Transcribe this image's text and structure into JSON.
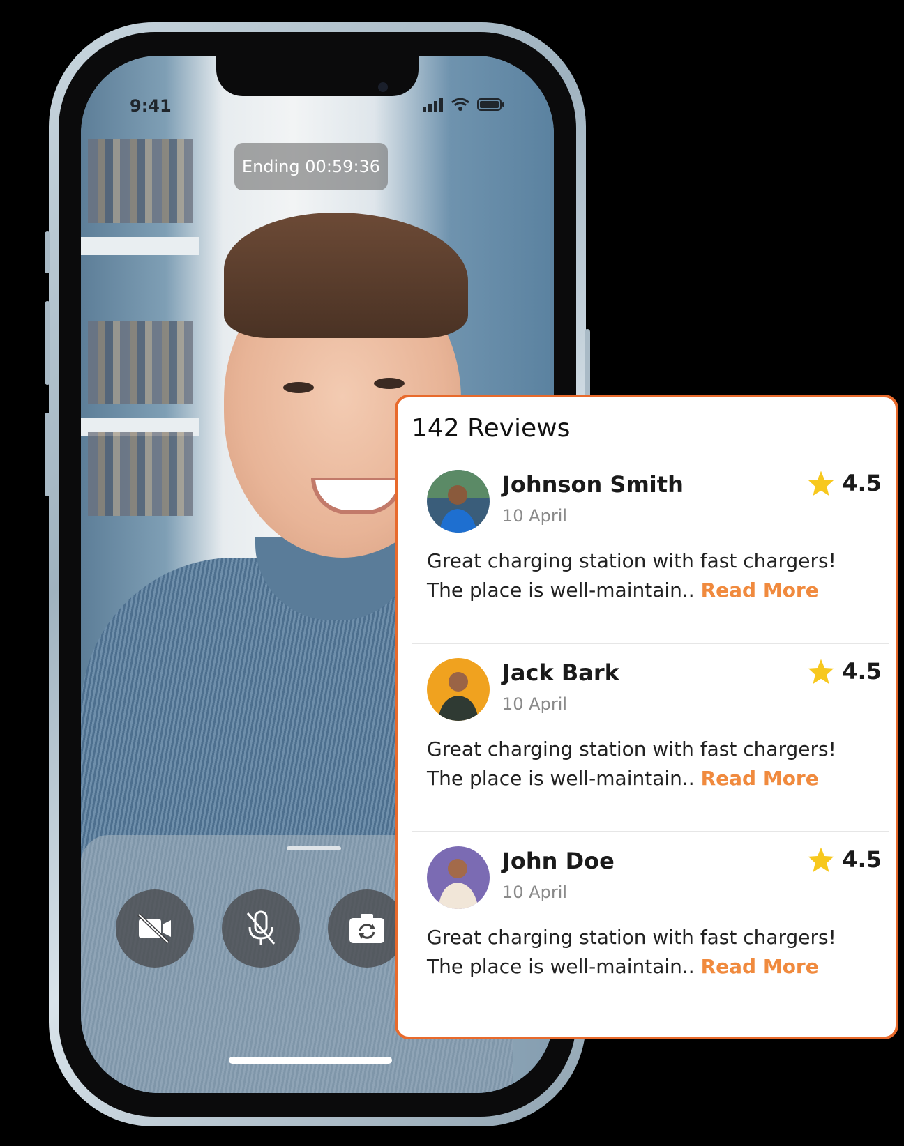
{
  "status_bar": {
    "time": "9:41",
    "icons": [
      "signal-icon",
      "wifi-icon",
      "battery-icon"
    ]
  },
  "call": {
    "timer_label": "Ending",
    "timer_value": "00:59:36"
  },
  "controls": [
    {
      "name": "camera-off-button",
      "icon": "video-off-icon"
    },
    {
      "name": "mute-button",
      "icon": "mic-off-icon"
    },
    {
      "name": "switch-camera-button",
      "icon": "camera-rotate-icon"
    }
  ],
  "reviews_panel": {
    "title": "142 Reviews",
    "accent_color": "#e86a2c",
    "read_more_color": "#f08a3e",
    "star_color": "#f7c81e",
    "reviews": [
      {
        "name": "Johnson Smith",
        "date": "10 April",
        "rating": "4.5",
        "text_line1": "Great charging station with fast chargers!",
        "text_line2": "The place is well-maintain..",
        "read_more": "Read More",
        "avatar_bg": "#3a5d7a"
      },
      {
        "name": "Jack Bark",
        "date": "10 April",
        "rating": "4.5",
        "text_line1": "Great charging station with fast chargers!",
        "text_line2": "The place is well-maintain..",
        "read_more": "Read More",
        "avatar_bg": "#f0a21f"
      },
      {
        "name": "John Doe",
        "date": "10 April",
        "rating": "4.5",
        "text_line1": "Great charging station with fast chargers!",
        "text_line2": "The place is well-maintain..",
        "read_more": "Read More",
        "avatar_bg": "#7b6bb3"
      }
    ]
  }
}
